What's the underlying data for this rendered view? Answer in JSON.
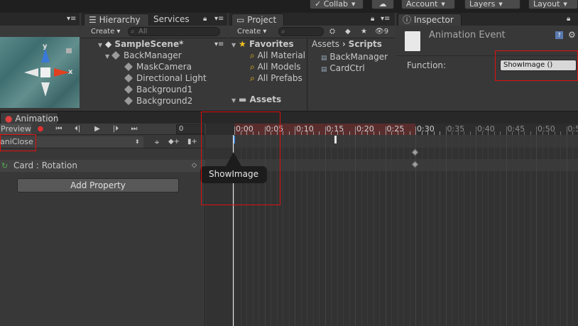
{
  "toolbar": {
    "collab": "Collab",
    "account": "Account",
    "layers": "Layers",
    "layout": "Layout"
  },
  "hierarchy": {
    "tab": "Hierarchy",
    "services_tab": "Services",
    "create": "Create",
    "search_placeholder": "All",
    "scene": "SampleScene*",
    "items": [
      "BackManager",
      "MaskCamera",
      "Directional Light",
      "Background1",
      "Background2"
    ]
  },
  "project": {
    "tab": "Project",
    "create": "Create",
    "favorites": "Favorites",
    "favorite_items": [
      "All Material",
      "All Models",
      "All Prefabs"
    ],
    "assets": "Assets",
    "breadcrumb_root": "Assets",
    "breadcrumb_current": "Scripts",
    "files": [
      "BackManager",
      "CardCtrl"
    ],
    "hidden_count": "9"
  },
  "inspector": {
    "tab": "Inspector",
    "title": "Animation Event",
    "function_label": "Function:",
    "function_value": "ShowImage ()"
  },
  "scene_gizmo": {
    "y": "y",
    "x": "x"
  },
  "animation": {
    "tab": "Animation",
    "preview": "Preview",
    "frame": "0",
    "clip": "aniClose",
    "property": "Card : Rotation",
    "add_property": "Add Property",
    "tooltip": "ShowImage",
    "ticks": [
      "0:00",
      "0:05",
      "0:10",
      "0:15",
      "0:20",
      "0:25",
      "0:30",
      "0:35",
      "0:40",
      "0:45",
      "0:50",
      "0:5"
    ]
  },
  "colors": {
    "highlight_red": "#e01010",
    "playhead": "#ffffff",
    "event_marker": "#4a8fe0",
    "clip_range": "#5a2d2d"
  }
}
